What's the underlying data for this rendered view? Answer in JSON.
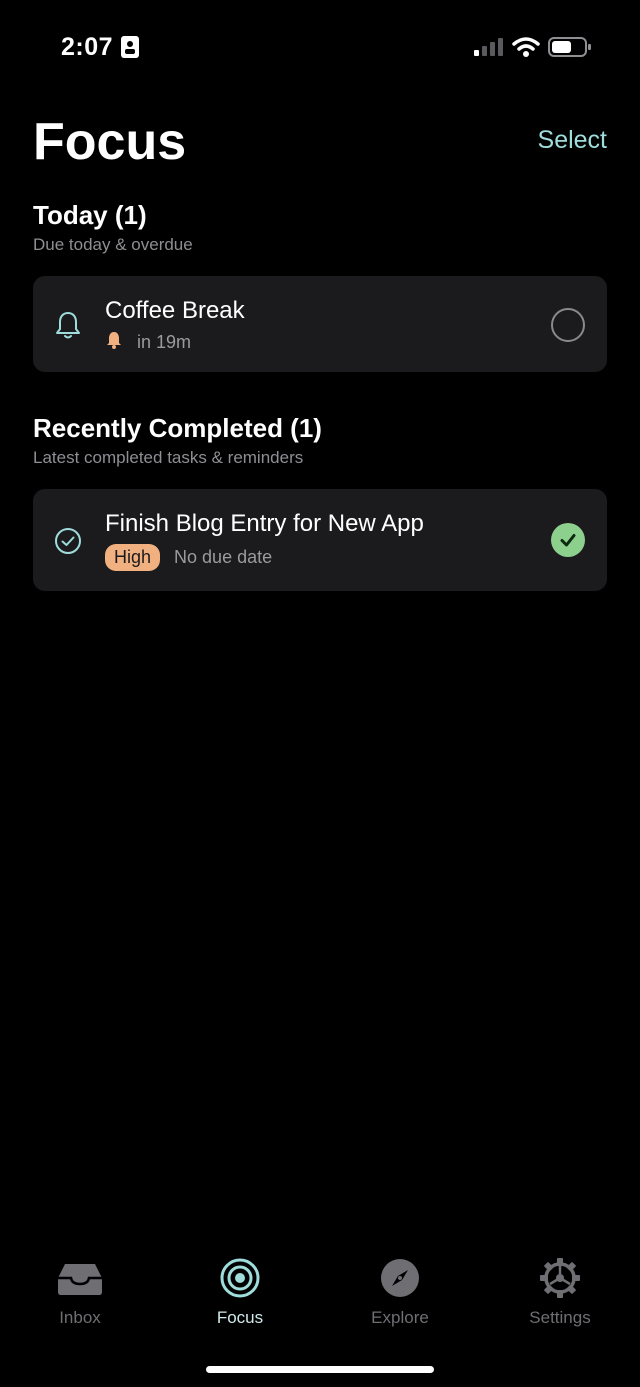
{
  "status_bar": {
    "time": "2:07"
  },
  "header": {
    "title": "Focus",
    "select_label": "Select"
  },
  "sections": {
    "today": {
      "title": "Today (1)",
      "subtitle": "Due today & overdue",
      "tasks": [
        {
          "title": "Coffee Break",
          "reminder": "in 19m",
          "icon": "bell-icon",
          "completed": false
        }
      ]
    },
    "recent": {
      "title": "Recently Completed (1)",
      "subtitle": "Latest completed tasks & reminders",
      "tasks": [
        {
          "title": "Finish Blog Entry for New App",
          "priority": "High",
          "due": "No due date",
          "icon": "check-circle-icon",
          "completed": true
        }
      ]
    }
  },
  "tab_bar": {
    "items": [
      {
        "label": "Inbox",
        "icon": "inbox-icon",
        "active": false
      },
      {
        "label": "Focus",
        "icon": "target-icon",
        "active": true
      },
      {
        "label": "Explore",
        "icon": "compass-icon",
        "active": false
      },
      {
        "label": "Settings",
        "icon": "gear-icon",
        "active": false
      }
    ]
  },
  "colors": {
    "accent": "#9fdcdc",
    "priority_high": "#f0b07f",
    "completed": "#8dd08e",
    "card_bg": "#1b1b1d"
  }
}
